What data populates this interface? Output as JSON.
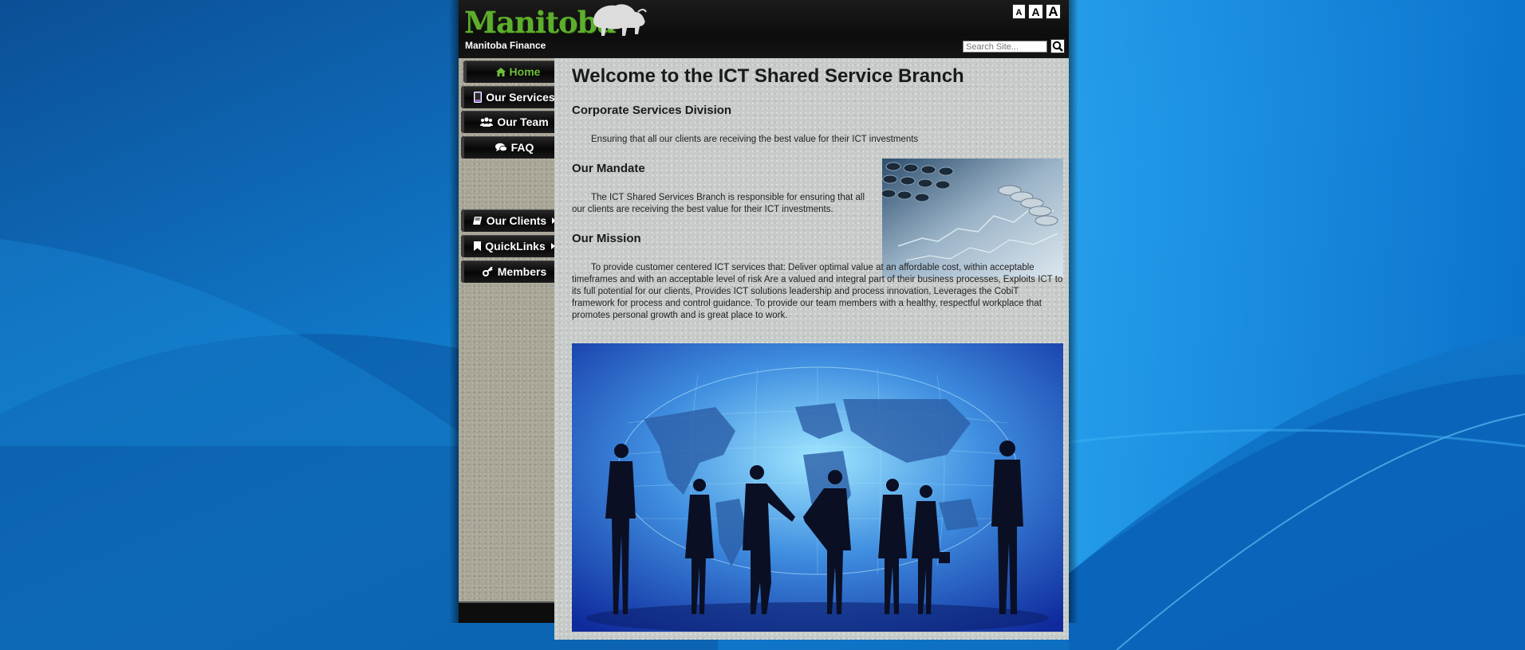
{
  "header": {
    "logo_text": "Manitoba",
    "department": "Manitoba Finance",
    "text_size_buttons": [
      "A",
      "A",
      "A"
    ],
    "search_placeholder": "Search Site..."
  },
  "nav": {
    "items": [
      {
        "label": "Home",
        "icon": "home-icon",
        "active": true
      },
      {
        "label": "Our Services",
        "icon": "tablet-icon"
      },
      {
        "label": "Our Team",
        "icon": "users-icon"
      },
      {
        "label": "FAQ",
        "icon": "comments-icon"
      },
      {
        "label": "Our Clients",
        "icon": "book-icon",
        "submenu": true
      },
      {
        "label": "QuickLinks",
        "icon": "bookmark-icon",
        "submenu": true
      },
      {
        "label": "Members",
        "icon": "key-icon"
      }
    ]
  },
  "main": {
    "title": "Welcome to the ICT Shared Service Branch",
    "division_heading": "Corporate Services Division",
    "division_text": "Ensuring that all our clients are receiving the best value for their ICT investments",
    "mandate_heading": "Our Mandate",
    "mandate_text": "The ICT Shared Services Branch is responsible for ensuring that all our clients are receiving the best value for their ICT investments.",
    "mission_heading": "Our Mission",
    "mission_text": "To provide customer centered ICT services that: Deliver optimal value at an affordable cost, within acceptable timeframes and with an acceptable level of risk Are a valued and integral part of their business processes, Exploits ICT to its full potential for our clients, Provides ICT solutions leadership and process innovation, Leverages the CobiT framework for process and control guidance. To provide our team members with a healthy, respectful workplace that promotes personal growth and is great place to work."
  },
  "colors": {
    "brand_green": "#5dae2d",
    "active_nav": "#6fbf3a",
    "header_bg": "#111111",
    "background_blue": "#0a5aa8"
  }
}
